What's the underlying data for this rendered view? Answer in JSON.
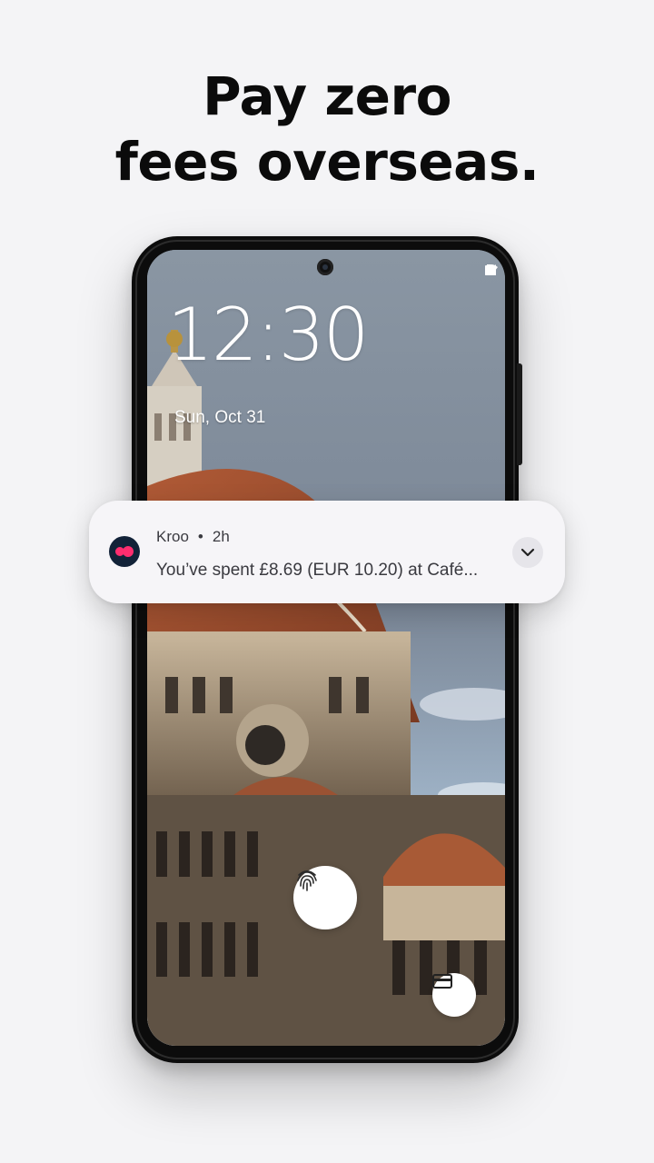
{
  "headline": {
    "line1": "Pay zero",
    "line2": "fees overseas."
  },
  "lockscreen": {
    "time": "12:30",
    "date": "Sun, Oct 31",
    "status_icons": [
      "wifi-icon",
      "signal-icon",
      "battery-icon"
    ]
  },
  "notification": {
    "app_name": "Kroo",
    "separator": "•",
    "age": "2h",
    "message": "You’ve spent £8.69 (EUR 10.20) at Café...",
    "brand_color": "#ff2d6f",
    "icon_bg": "#122238"
  },
  "icons": {
    "fingerprint": "fingerprint-icon",
    "wallet": "wallet-card-icon",
    "expand": "chevron-down-icon"
  }
}
